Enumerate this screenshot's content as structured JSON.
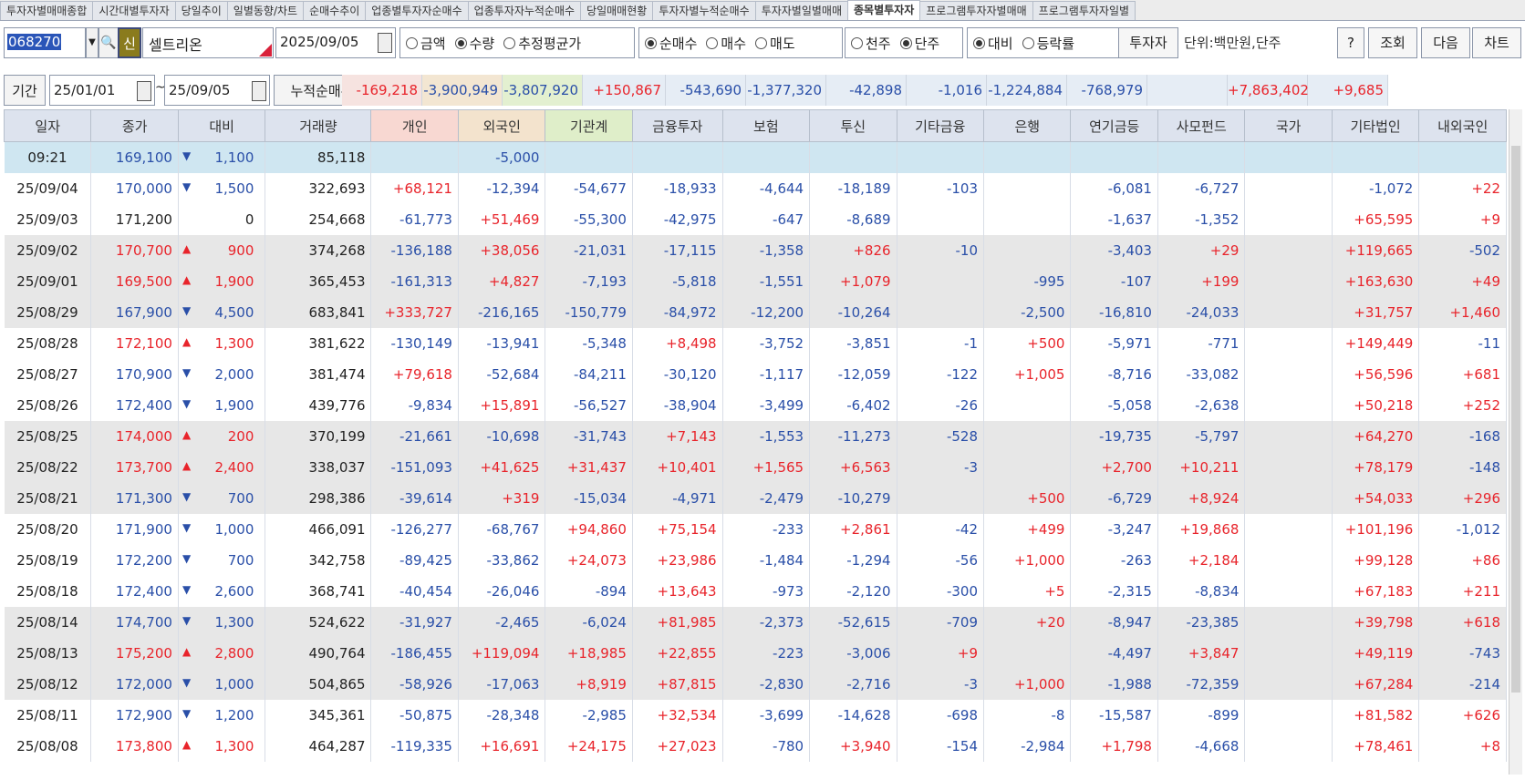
{
  "tabs": [
    "투자자별매매종합",
    "시간대별투자자",
    "당일추이",
    "일별동향/차트",
    "순매수추이",
    "업종별투자자순매수",
    "업종투자자누적순매수",
    "당일매매현황",
    "투자자별누적순매수",
    "투자자별일별매매",
    "종목별투자자",
    "프로그램투자자별매매",
    "프로그램투자자일별"
  ],
  "active_tab": "종목별투자자",
  "toolbar": {
    "code": "068270",
    "new_badge": "신",
    "stock_name": "셀트리온",
    "date": "2025/09/05",
    "radio1": [
      {
        "label": "금액",
        "on": false
      },
      {
        "label": "수량",
        "on": true
      },
      {
        "label": "추정평균가",
        "on": false
      }
    ],
    "radio2": [
      {
        "label": "순매수",
        "on": true
      },
      {
        "label": "매수",
        "on": false
      },
      {
        "label": "매도",
        "on": false
      }
    ],
    "radio3": [
      {
        "label": "천주",
        "on": false
      },
      {
        "label": "단주",
        "on": true
      }
    ],
    "radio4": [
      {
        "label": "대비",
        "on": true
      },
      {
        "label": "등락률",
        "on": false
      }
    ],
    "investor_btn": "투자자",
    "unit_text": "단위:백만원,단주",
    "help_btn": "?",
    "query_btn": "조회",
    "next_btn": "다음",
    "chart_btn": "차트"
  },
  "period": {
    "label": "기간",
    "from": "25/01/01",
    "to": "25/09/05",
    "tilde": "~",
    "cum_label": "누적순매수",
    "cum_values": [
      {
        "v": "-169,218",
        "cls": "red",
        "bg": "#f6e3e0"
      },
      {
        "v": "-3,900,949",
        "cls": "blue",
        "bg": "#f3e6d2"
      },
      {
        "v": "-3,807,920",
        "cls": "blue",
        "bg": "#e3f0d0"
      },
      {
        "v": "+150,867",
        "cls": "red",
        "bg": "#e6edf5"
      },
      {
        "v": "-543,690",
        "cls": "blue",
        "bg": "#e6edf5"
      },
      {
        "v": "-1,377,320",
        "cls": "blue",
        "bg": "#e6edf5"
      },
      {
        "v": "-42,898",
        "cls": "blue",
        "bg": "#e6edf5"
      },
      {
        "v": "-1,016",
        "cls": "blue",
        "bg": "#e6edf5"
      },
      {
        "v": "-1,224,884",
        "cls": "blue",
        "bg": "#e6edf5"
      },
      {
        "v": "-768,979",
        "cls": "blue",
        "bg": "#e6edf5"
      },
      {
        "v": "",
        "cls": "blue",
        "bg": "#e6edf5"
      },
      {
        "v": "+7,863,402",
        "cls": "red",
        "bg": "#e6edf5"
      },
      {
        "v": "+9,685",
        "cls": "red",
        "bg": "#e6edf5"
      }
    ]
  },
  "columns": [
    "일자",
    "종가",
    "대비",
    "거래량",
    "개인",
    "외국인",
    "기관계",
    "금융투자",
    "보험",
    "투신",
    "기타금융",
    "은행",
    "연기금등",
    "사모펀드",
    "국가",
    "기타법인",
    "내외국인"
  ],
  "rows": [
    {
      "bg": "live",
      "d": "09:21",
      "p": "169,100",
      "pc": "blue",
      "a": "▼",
      "ch": "1,100",
      "v": "85,118",
      "n": [
        "",
        "-5,000",
        "",
        "",
        "",
        "",
        "",
        "",
        "",
        "",
        "",
        "",
        ""
      ]
    },
    {
      "bg": "white",
      "d": "25/09/04",
      "p": "170,000",
      "pc": "blue",
      "a": "▼",
      "ch": "1,500",
      "v": "322,693",
      "n": [
        "+68,121",
        "-12,394",
        "-54,677",
        "-18,933",
        "-4,644",
        "-18,189",
        "-103",
        "",
        "-6,081",
        "-6,727",
        "",
        "-1,072",
        "+22"
      ]
    },
    {
      "bg": "white",
      "d": "25/09/03",
      "p": "171,200",
      "pc": "black",
      "a": "",
      "ch": "0",
      "v": "254,668",
      "n": [
        "-61,773",
        "+51,469",
        "-55,300",
        "-42,975",
        "-647",
        "-8,689",
        "",
        "",
        "-1,637",
        "-1,352",
        "",
        "+65,595",
        "+9"
      ]
    },
    {
      "bg": "gray",
      "d": "25/09/02",
      "p": "170,700",
      "pc": "red",
      "a": "▲",
      "ch": "900",
      "v": "374,268",
      "n": [
        "-136,188",
        "+38,056",
        "-21,031",
        "-17,115",
        "-1,358",
        "+826",
        "-10",
        "",
        "-3,403",
        "+29",
        "",
        "+119,665",
        "-502"
      ]
    },
    {
      "bg": "gray",
      "d": "25/09/01",
      "p": "169,500",
      "pc": "red",
      "a": "▲",
      "ch": "1,900",
      "v": "365,453",
      "n": [
        "-161,313",
        "+4,827",
        "-7,193",
        "-5,818",
        "-1,551",
        "+1,079",
        "",
        "-995",
        "-107",
        "+199",
        "",
        "+163,630",
        "+49"
      ]
    },
    {
      "bg": "gray",
      "d": "25/08/29",
      "p": "167,900",
      "pc": "blue",
      "a": "▼",
      "ch": "4,500",
      "v": "683,841",
      "n": [
        "+333,727",
        "-216,165",
        "-150,779",
        "-84,972",
        "-12,200",
        "-10,264",
        "",
        "-2,500",
        "-16,810",
        "-24,033",
        "",
        "+31,757",
        "+1,460"
      ]
    },
    {
      "bg": "white",
      "d": "25/08/28",
      "p": "172,100",
      "pc": "red",
      "a": "▲",
      "ch": "1,300",
      "v": "381,622",
      "n": [
        "-130,149",
        "-13,941",
        "-5,348",
        "+8,498",
        "-3,752",
        "-3,851",
        "-1",
        "+500",
        "-5,971",
        "-771",
        "",
        "+149,449",
        "-11"
      ]
    },
    {
      "bg": "white",
      "d": "25/08/27",
      "p": "170,900",
      "pc": "blue",
      "a": "▼",
      "ch": "2,000",
      "v": "381,474",
      "n": [
        "+79,618",
        "-52,684",
        "-84,211",
        "-30,120",
        "-1,117",
        "-12,059",
        "-122",
        "+1,005",
        "-8,716",
        "-33,082",
        "",
        "+56,596",
        "+681"
      ]
    },
    {
      "bg": "white",
      "d": "25/08/26",
      "p": "172,400",
      "pc": "blue",
      "a": "▼",
      "ch": "1,900",
      "v": "439,776",
      "n": [
        "-9,834",
        "+15,891",
        "-56,527",
        "-38,904",
        "-3,499",
        "-6,402",
        "-26",
        "",
        "-5,058",
        "-2,638",
        "",
        "+50,218",
        "+252"
      ]
    },
    {
      "bg": "gray",
      "d": "25/08/25",
      "p": "174,000",
      "pc": "red",
      "a": "▲",
      "ch": "200",
      "v": "370,199",
      "n": [
        "-21,661",
        "-10,698",
        "-31,743",
        "+7,143",
        "-1,553",
        "-11,273",
        "-528",
        "",
        "-19,735",
        "-5,797",
        "",
        "+64,270",
        "-168"
      ]
    },
    {
      "bg": "gray",
      "d": "25/08/22",
      "p": "173,700",
      "pc": "red",
      "a": "▲",
      "ch": "2,400",
      "v": "338,037",
      "n": [
        "-151,093",
        "+41,625",
        "+31,437",
        "+10,401",
        "+1,565",
        "+6,563",
        "-3",
        "",
        "+2,700",
        "+10,211",
        "",
        "+78,179",
        "-148"
      ]
    },
    {
      "bg": "gray",
      "d": "25/08/21",
      "p": "171,300",
      "pc": "blue",
      "a": "▼",
      "ch": "700",
      "v": "298,386",
      "n": [
        "-39,614",
        "+319",
        "-15,034",
        "-4,971",
        "-2,479",
        "-10,279",
        "",
        "+500",
        "-6,729",
        "+8,924",
        "",
        "+54,033",
        "+296"
      ]
    },
    {
      "bg": "white",
      "d": "25/08/20",
      "p": "171,900",
      "pc": "blue",
      "a": "▼",
      "ch": "1,000",
      "v": "466,091",
      "n": [
        "-126,277",
        "-68,767",
        "+94,860",
        "+75,154",
        "-233",
        "+2,861",
        "-42",
        "+499",
        "-3,247",
        "+19,868",
        "",
        "+101,196",
        "-1,012"
      ]
    },
    {
      "bg": "white",
      "d": "25/08/19",
      "p": "172,200",
      "pc": "blue",
      "a": "▼",
      "ch": "700",
      "v": "342,758",
      "n": [
        "-89,425",
        "-33,862",
        "+24,073",
        "+23,986",
        "-1,484",
        "-1,294",
        "-56",
        "+1,000",
        "-263",
        "+2,184",
        "",
        "+99,128",
        "+86"
      ]
    },
    {
      "bg": "white",
      "d": "25/08/18",
      "p": "172,400",
      "pc": "blue",
      "a": "▼",
      "ch": "2,600",
      "v": "368,741",
      "n": [
        "-40,454",
        "-26,046",
        "-894",
        "+13,643",
        "-973",
        "-2,120",
        "-300",
        "+5",
        "-2,315",
        "-8,834",
        "",
        "+67,183",
        "+211"
      ]
    },
    {
      "bg": "gray",
      "d": "25/08/14",
      "p": "174,700",
      "pc": "blue",
      "a": "▼",
      "ch": "1,300",
      "v": "524,622",
      "n": [
        "-31,927",
        "-2,465",
        "-6,024",
        "+81,985",
        "-2,373",
        "-52,615",
        "-709",
        "+20",
        "-8,947",
        "-23,385",
        "",
        "+39,798",
        "+618"
      ]
    },
    {
      "bg": "gray",
      "d": "25/08/13",
      "p": "175,200",
      "pc": "red",
      "a": "▲",
      "ch": "2,800",
      "v": "490,764",
      "n": [
        "-186,455",
        "+119,094",
        "+18,985",
        "+22,855",
        "-223",
        "-3,006",
        "+9",
        "",
        "-4,497",
        "+3,847",
        "",
        "+49,119",
        "-743"
      ]
    },
    {
      "bg": "gray",
      "d": "25/08/12",
      "p": "172,000",
      "pc": "blue",
      "a": "▼",
      "ch": "1,000",
      "v": "504,865",
      "n": [
        "-58,926",
        "-17,063",
        "+8,919",
        "+87,815",
        "-2,830",
        "-2,716",
        "-3",
        "+1,000",
        "-1,988",
        "-72,359",
        "",
        "+67,284",
        "-214"
      ]
    },
    {
      "bg": "white",
      "d": "25/08/11",
      "p": "172,900",
      "pc": "blue",
      "a": "▼",
      "ch": "1,200",
      "v": "345,361",
      "n": [
        "-50,875",
        "-28,348",
        "-2,985",
        "+32,534",
        "-3,699",
        "-14,628",
        "-698",
        "-8",
        "-15,587",
        "-899",
        "",
        "+81,582",
        "+626"
      ]
    },
    {
      "bg": "white",
      "d": "25/08/08",
      "p": "173,800",
      "pc": "red",
      "a": "▲",
      "ch": "1,300",
      "v": "464,287",
      "n": [
        "-119,335",
        "+16,691",
        "+24,175",
        "+27,023",
        "-780",
        "+3,940",
        "-154",
        "-2,984",
        "+1,798",
        "-4,668",
        "",
        "+78,461",
        "+8"
      ]
    }
  ]
}
